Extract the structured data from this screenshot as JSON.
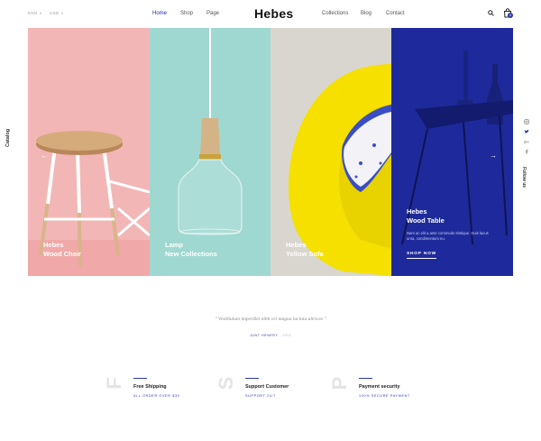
{
  "header": {
    "language": "ENG",
    "currency": "USD",
    "nav_left": [
      "Home",
      "Shop",
      "Page"
    ],
    "logo": "Hebes",
    "nav_right": [
      "Collections",
      "Blog",
      "Contact"
    ],
    "cart_count": "0"
  },
  "side": {
    "catalog_label": "Catalog",
    "follow_label": "Follow us",
    "social_icons": [
      "instagram-icon",
      "twitter-icon",
      "google-plus-icon",
      "facebook-icon"
    ]
  },
  "panels": [
    {
      "line1": "Hebes",
      "line2": "Wood Chair"
    },
    {
      "line1": "Lamp",
      "line2": "New Collections"
    },
    {
      "line1": "Hebes",
      "line2": "Yellow Sofa"
    },
    {
      "line1": "Hebes",
      "line2": "Wood Table",
      "description": "Nam ac elit a ante commodo tristique. Duis lacus urna, condimentum eu.",
      "cta": "SHOP NOW"
    }
  ],
  "arrows": {
    "prev": "←",
    "next": "→"
  },
  "quote": {
    "text": "\" Vestibulum imperdiet nibh vel magna lacinia ultrices \"",
    "author": "JUNT HENERY",
    "role": "- CEO"
  },
  "features": [
    {
      "letter": "F",
      "title": "Free Shipping",
      "subtitle": "ALL ORDER OVER $30"
    },
    {
      "letter": "S",
      "title": "Support Customer",
      "subtitle": "SUPPORT 24/7"
    },
    {
      "letter": "P",
      "title": "Payment security",
      "subtitle": "100% SECURE PAYMENT"
    }
  ],
  "colors": {
    "accent": "#2a3aa8",
    "panel_pink": "#f2b6b6",
    "panel_teal": "#9fd8d0",
    "panel_beige": "#d9d6d0",
    "panel_blue": "#1e2a9b",
    "sofa_yellow": "#f5e000"
  }
}
